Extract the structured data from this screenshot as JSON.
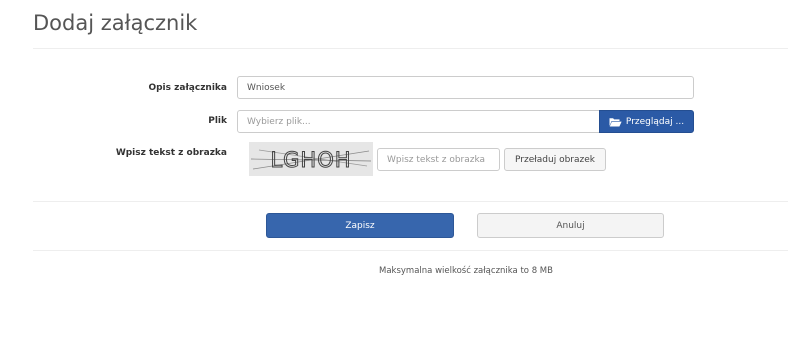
{
  "page": {
    "title": "Dodaj załącznik"
  },
  "form": {
    "description_label": "Opis załącznika",
    "description_value": "Wniosek",
    "file_label": "Plik",
    "file_placeholder": "Wybierz plik...",
    "browse_button": "Przeglądaj ...",
    "browse_icon": "folder-open-icon",
    "captcha_label": "Wpisz tekst z obrazka",
    "captcha_text": "LGHOH",
    "captcha_placeholder": "Wpisz tekst z obrazka",
    "reload_button": "Przeładuj obrazek"
  },
  "actions": {
    "save": "Zapisz",
    "cancel": "Anuluj"
  },
  "footer": {
    "note": "Maksymalna wielkość załącznika to 8 MB"
  },
  "colors": {
    "primary": "#3766ad",
    "browse": "#2b5aa6"
  }
}
